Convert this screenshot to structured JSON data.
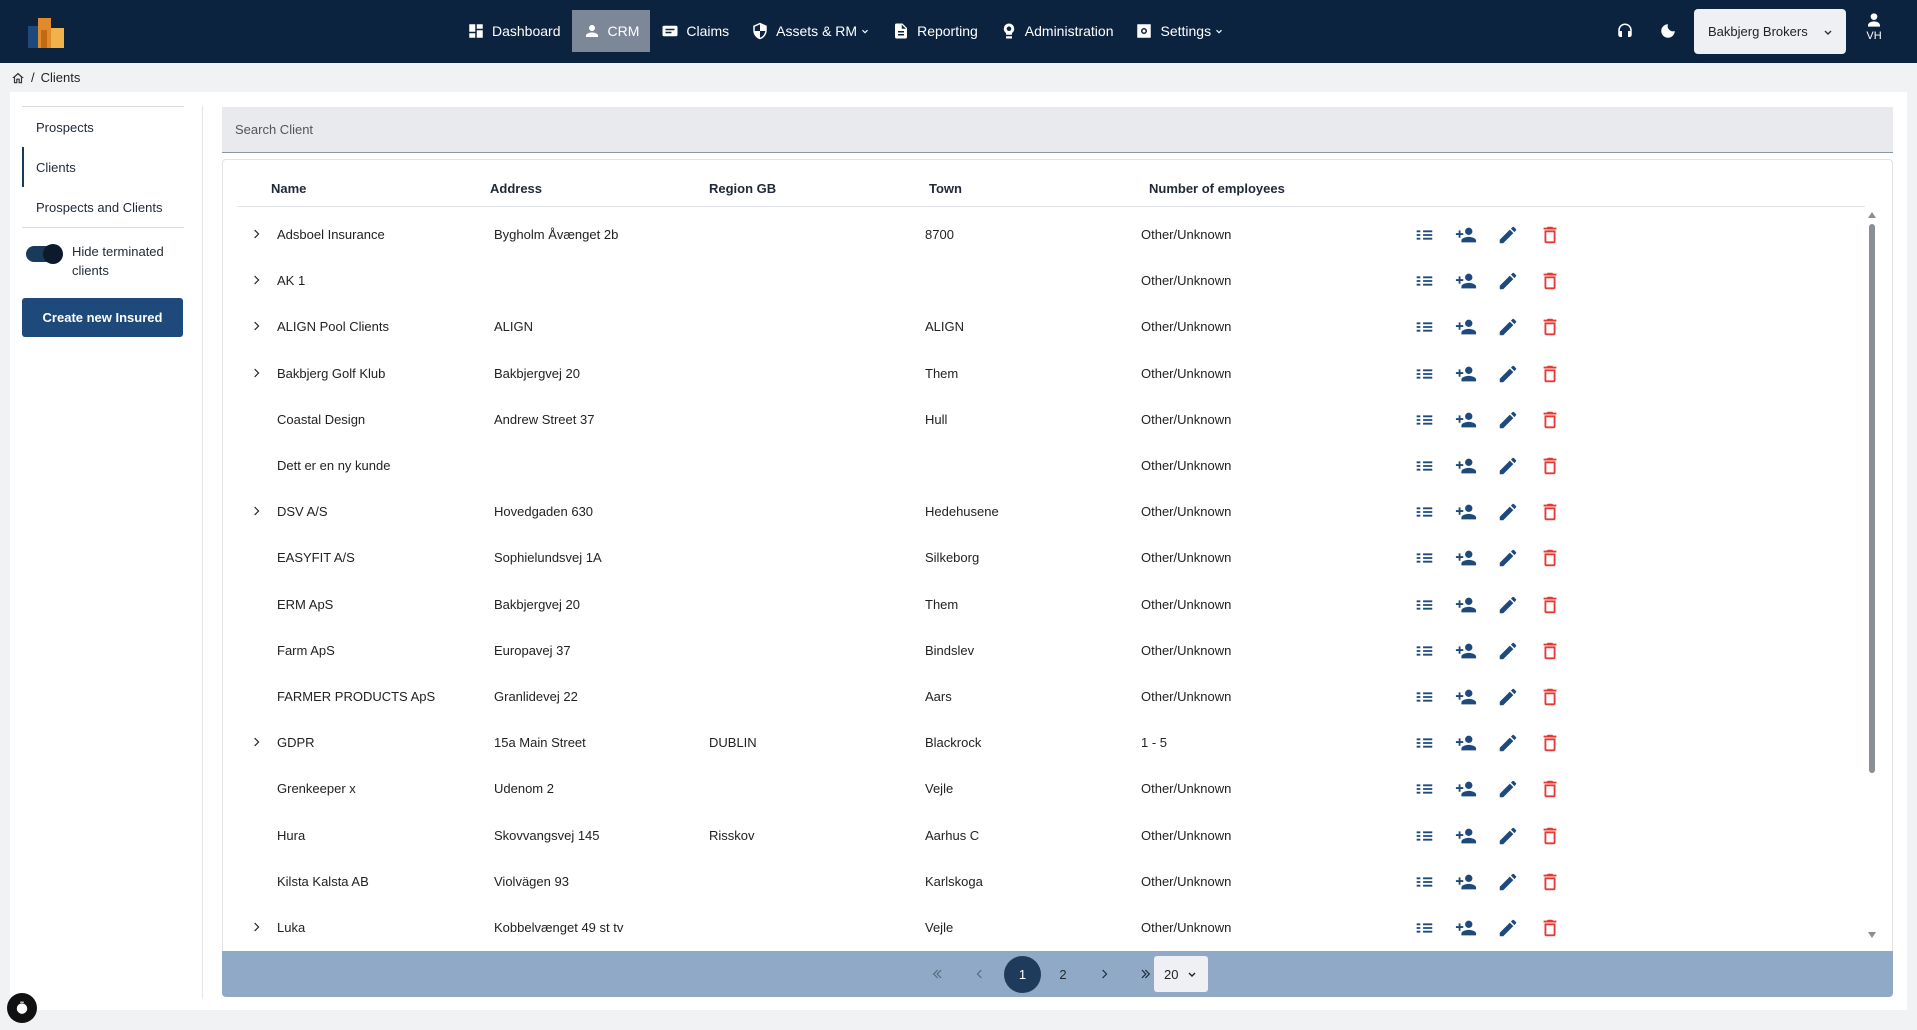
{
  "nav": {
    "items": [
      {
        "label": "Dashboard",
        "icon": "dashboard-icon"
      },
      {
        "label": "CRM",
        "icon": "person-icon",
        "active": true
      },
      {
        "label": "Claims",
        "icon": "claims-icon"
      },
      {
        "label": "Assets & RM",
        "icon": "shield-icon",
        "dropdown": true
      },
      {
        "label": "Reporting",
        "icon": "document-icon"
      },
      {
        "label": "Administration",
        "icon": "admin-gear-icon"
      },
      {
        "label": "Settings",
        "icon": "settings-icon",
        "dropdown": true
      }
    ],
    "broker": "Bakbjerg Brokers",
    "user_initials": "VH"
  },
  "breadcrumb": {
    "current": "Clients"
  },
  "sidebar": {
    "items": [
      "Prospects",
      "Clients",
      "Prospects and Clients"
    ],
    "active": "Clients",
    "toggle_label": "Hide terminated clients",
    "toggle_on": true,
    "create_button": "Create new Insured"
  },
  "search": {
    "placeholder": "Search Client",
    "value": ""
  },
  "table": {
    "columns": [
      "Name",
      "Address",
      "Region GB",
      "Town",
      "Number of employees"
    ],
    "rows": [
      {
        "expandable": true,
        "name": "Adsboel Insurance",
        "address": "Bygholm Åvænget 2b",
        "region": "",
        "town": "8700",
        "employees": "Other/Unknown"
      },
      {
        "expandable": true,
        "name": "AK 1",
        "address": "",
        "region": "",
        "town": "",
        "employees": "Other/Unknown"
      },
      {
        "expandable": true,
        "name": "ALIGN Pool Clients",
        "address": "ALIGN",
        "region": "",
        "town": "ALIGN",
        "employees": "Other/Unknown"
      },
      {
        "expandable": true,
        "name": "Bakbjerg Golf Klub",
        "address": "Bakbjergvej 20",
        "region": "",
        "town": "Them",
        "employees": "Other/Unknown"
      },
      {
        "expandable": false,
        "name": "Coastal Design",
        "address": "Andrew Street 37",
        "region": "",
        "town": "Hull",
        "employees": "Other/Unknown"
      },
      {
        "expandable": false,
        "name": "Dett er en ny kunde",
        "address": "",
        "region": "",
        "town": "",
        "employees": "Other/Unknown"
      },
      {
        "expandable": true,
        "name": "DSV A/S",
        "address": "Hovedgaden 630",
        "region": "",
        "town": "Hedehusene",
        "employees": "Other/Unknown"
      },
      {
        "expandable": false,
        "name": "EASYFIT A/S",
        "address": "Sophielundsvej 1A",
        "region": "",
        "town": "Silkeborg",
        "employees": "Other/Unknown"
      },
      {
        "expandable": false,
        "name": "ERM ApS",
        "address": "Bakbjergvej 20",
        "region": "",
        "town": "Them",
        "employees": "Other/Unknown"
      },
      {
        "expandable": false,
        "name": "Farm ApS",
        "address": "Europavej 37",
        "region": "",
        "town": "Bindslev",
        "employees": "Other/Unknown"
      },
      {
        "expandable": false,
        "name": "FARMER PRODUCTS ApS",
        "address": "Granlidevej 22",
        "region": "",
        "town": "Aars",
        "employees": "Other/Unknown"
      },
      {
        "expandable": true,
        "name": "GDPR",
        "address": "15a Main Street",
        "region": "DUBLIN",
        "town": "Blackrock",
        "employees": "1 - 5"
      },
      {
        "expandable": false,
        "name": "Grenkeeper x",
        "address": "Udenom 2",
        "region": "",
        "town": "Vejle",
        "employees": "Other/Unknown"
      },
      {
        "expandable": false,
        "name": "Hura",
        "address": "Skovvangsvej 145",
        "region": "Risskov",
        "town": "Aarhus C",
        "employees": "Other/Unknown"
      },
      {
        "expandable": false,
        "name": "Kilsta Kalsta AB",
        "address": "Violvägen 93",
        "region": "",
        "town": "Karlskoga",
        "employees": "Other/Unknown"
      },
      {
        "expandable": true,
        "name": "Luka",
        "address": "Kobbelvænget 49 st tv",
        "region": "",
        "town": "Vejle",
        "employees": "Other/Unknown"
      }
    ],
    "row_actions": [
      "details-list-icon",
      "add-contact-icon",
      "edit-pencil-icon",
      "delete-trash-icon"
    ]
  },
  "pagination": {
    "pages": [
      "1",
      "2"
    ],
    "current": "1",
    "page_size": "20"
  },
  "colors": {
    "navbar": "#0c2340",
    "primary": "#1d4a7a",
    "pager": "#8fa9c6",
    "delete": "#e53935",
    "action": "#1d4a7a"
  }
}
